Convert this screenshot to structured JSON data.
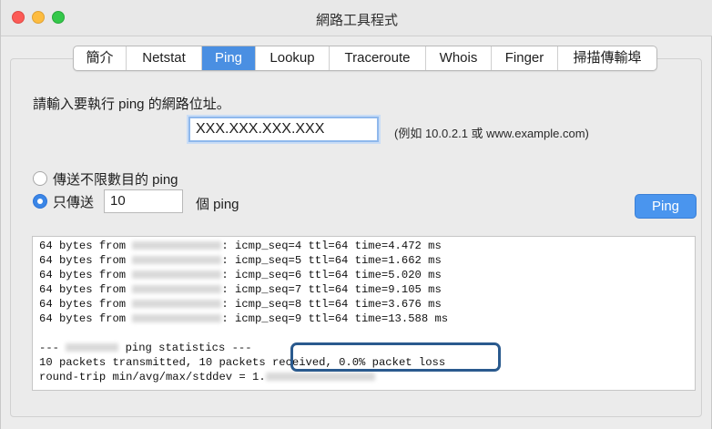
{
  "window": {
    "title": "網路工具程式"
  },
  "tabs": [
    {
      "label": "簡介",
      "active": false
    },
    {
      "label": "Netstat",
      "active": false
    },
    {
      "label": "Ping",
      "active": true
    },
    {
      "label": "Lookup",
      "active": false
    },
    {
      "label": "Traceroute",
      "active": false
    },
    {
      "label": "Whois",
      "active": false
    },
    {
      "label": "Finger",
      "active": false
    },
    {
      "label": "掃描傳輸埠",
      "active": false
    }
  ],
  "ping": {
    "prompt": "請輸入要執行 ping 的網路位址。",
    "address_value": "XXX.XXX.XXX.XXX",
    "example_hint": "(例如 10.0.2.1 或 www.example.com)",
    "radio_unlimited_label": "傳送不限數目的 ping",
    "radio_limited_label": "只傳送",
    "selected_option": "只傳送",
    "count_value": "10",
    "count_unit": "個 ping",
    "button_label": "Ping"
  },
  "output": {
    "ping_lines": [
      {
        "prefix": "64 bytes from ",
        "suffix": ": icmp_seq=4 ttl=64 time=4.472 ms"
      },
      {
        "prefix": "64 bytes from ",
        "suffix": ": icmp_seq=5 ttl=64 time=1.662 ms"
      },
      {
        "prefix": "64 bytes from ",
        "suffix": ": icmp_seq=6 ttl=64 time=5.020 ms"
      },
      {
        "prefix": "64 bytes from ",
        "suffix": ": icmp_seq=7 ttl=64 time=9.105 ms"
      },
      {
        "prefix": "64 bytes from ",
        "suffix": ": icmp_seq=8 ttl=64 time=3.676 ms"
      },
      {
        "prefix": "64 bytes from ",
        "suffix": ": icmp_seq=9 ttl=64 time=13.588 ms"
      }
    ],
    "stats_prefix": "--- ",
    "stats_suffix": " ping statistics ---",
    "summary_line": "10 packets transmitted, 10 packets received, 0.0% packet loss",
    "roundtrip_prefix": "round-trip min/avg/max/stddev = 1."
  },
  "colors": {
    "accent": "#4a8fe2",
    "highlight_border": "#2a5a8e",
    "close": "#fc5b57",
    "minimize": "#fdbc40",
    "maximize": "#34c84a"
  }
}
